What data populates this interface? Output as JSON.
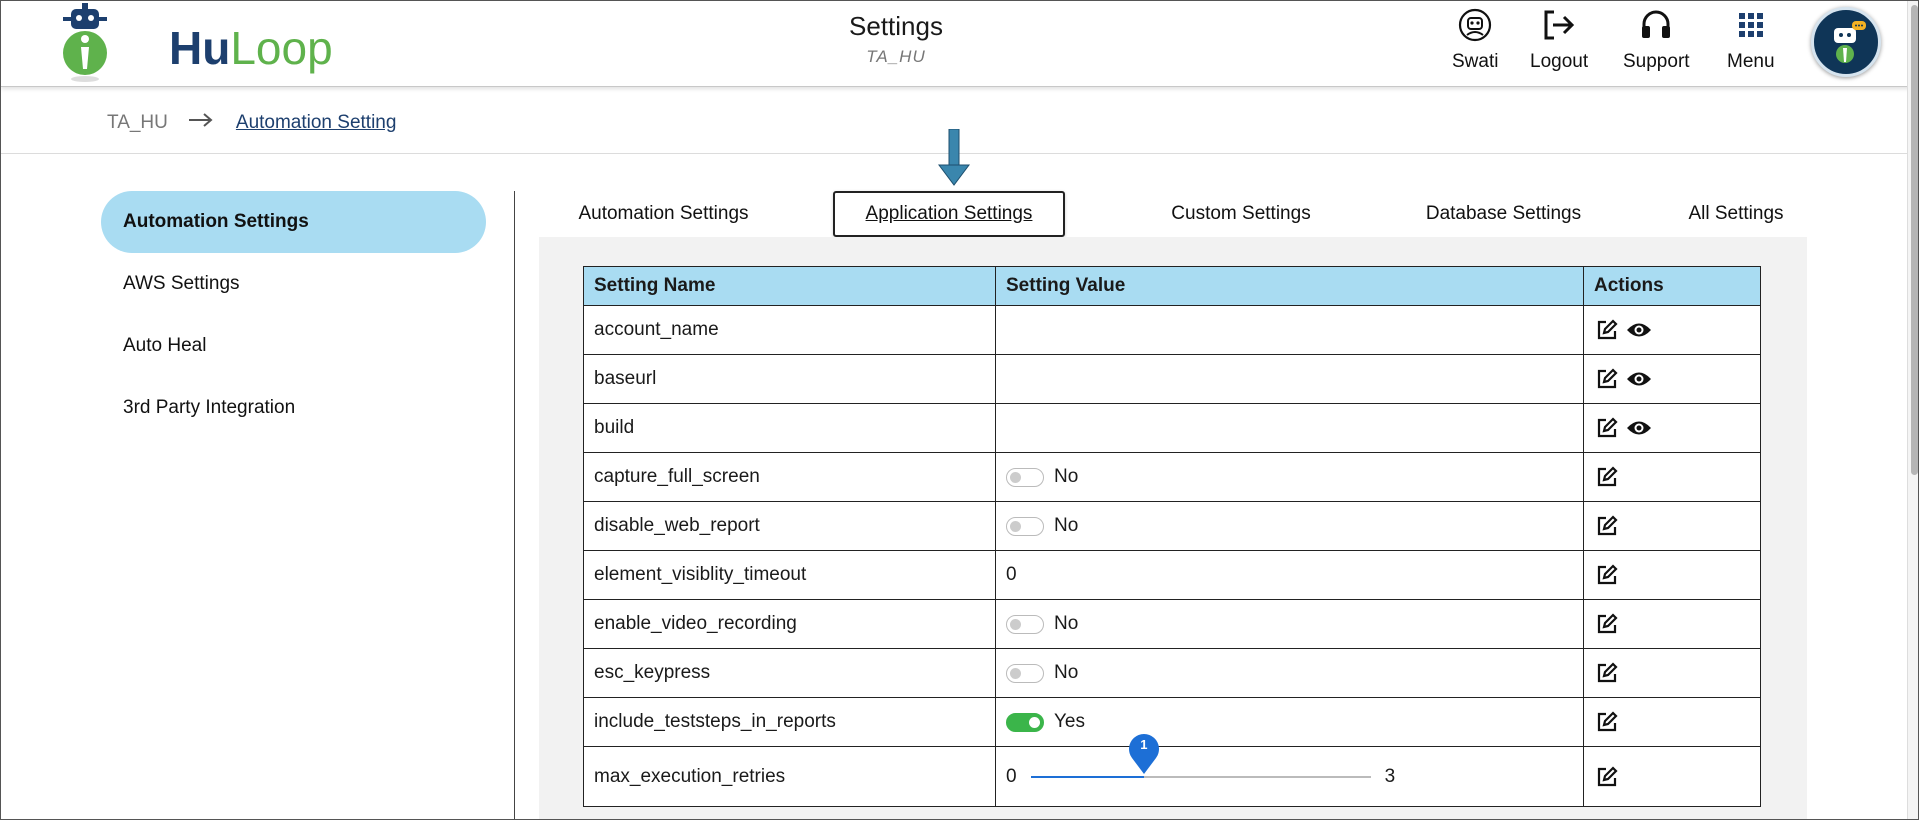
{
  "header": {
    "logo": {
      "hu": "Hu",
      "loop": "Loop"
    },
    "title": "Settings",
    "subtitle": "TA_HU",
    "nav": [
      {
        "label": "Swati",
        "icon": "user-robot-icon"
      },
      {
        "label": "Logout",
        "icon": "logout-icon"
      },
      {
        "label": "Support",
        "icon": "headset-icon"
      },
      {
        "label": "Menu",
        "icon": "grid-menu-icon"
      }
    ]
  },
  "breadcrumb": {
    "root": "TA_HU",
    "current": "Automation Setting"
  },
  "sidebar": {
    "items": [
      {
        "label": "Automation Settings",
        "active": true
      },
      {
        "label": "AWS Settings",
        "active": false
      },
      {
        "label": "Auto Heal",
        "active": false
      },
      {
        "label": "3rd Party Integration",
        "active": false
      }
    ]
  },
  "tabs": [
    {
      "label": "Automation Settings",
      "active": false
    },
    {
      "label": "Application Settings",
      "active": true
    },
    {
      "label": "Custom Settings",
      "active": false
    },
    {
      "label": "Database Settings",
      "active": false
    },
    {
      "label": "All Settings",
      "active": false
    }
  ],
  "table": {
    "headers": [
      "Setting Name",
      "Setting Value",
      "Actions"
    ],
    "rows": [
      {
        "name": "account_name",
        "type": "text",
        "value": "",
        "view": true
      },
      {
        "name": "baseurl",
        "type": "text",
        "value": "",
        "view": true
      },
      {
        "name": "build",
        "type": "text",
        "value": "",
        "view": true
      },
      {
        "name": "capture_full_screen",
        "type": "toggle",
        "value": "No",
        "on": false,
        "view": false
      },
      {
        "name": "disable_web_report",
        "type": "toggle",
        "value": "No",
        "on": false,
        "view": false
      },
      {
        "name": "element_visiblity_timeout",
        "type": "text",
        "value": "0",
        "view": false
      },
      {
        "name": "enable_video_recording",
        "type": "toggle",
        "value": "No",
        "on": false,
        "view": false
      },
      {
        "name": "esc_keypress",
        "type": "toggle",
        "value": "No",
        "on": false,
        "view": false
      },
      {
        "name": "include_teststeps_in_reports",
        "type": "toggle",
        "value": "Yes",
        "on": true,
        "view": false
      },
      {
        "name": "max_execution_retries",
        "type": "slider",
        "min": "0",
        "max": "3",
        "current": "1",
        "view": false
      }
    ]
  },
  "colors": {
    "accent": "#a9dcf2",
    "brand_dark": "#1d3f6e",
    "brand_green": "#5fb24c",
    "toggle_on": "#3bb54a",
    "slider": "#1d6fd6"
  }
}
